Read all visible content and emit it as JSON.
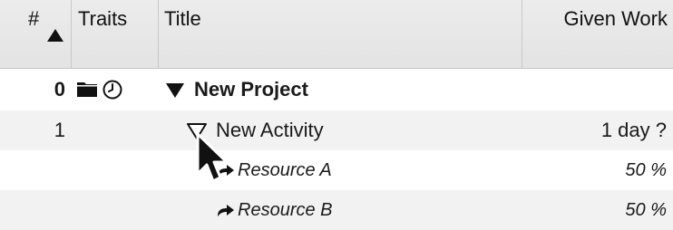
{
  "header": {
    "num": "#",
    "traits": "Traits",
    "title": "Title",
    "given_work": "Given Work",
    "sort_icon": "sort-ascending-triangle"
  },
  "rows": [
    {
      "num": "0",
      "title": "New Project",
      "given_work": "",
      "traits_icons": [
        "folder-icon",
        "clock-icon"
      ],
      "expander": "expanded-filled"
    },
    {
      "num": "1",
      "title": "New Activity",
      "given_work": "1 day ?",
      "expander": "expanded-outline"
    },
    {
      "num": "",
      "title": "Resource A",
      "given_work": "50 %",
      "icon": "assignment-arrow-icon"
    },
    {
      "num": "",
      "title": "Resource B",
      "given_work": "50 %",
      "icon": "assignment-arrow-icon"
    }
  ],
  "colors": {
    "header_bg": "#e6e6e6",
    "alt_row_bg": "#f2f2f2",
    "text": "#1a1a1a"
  }
}
